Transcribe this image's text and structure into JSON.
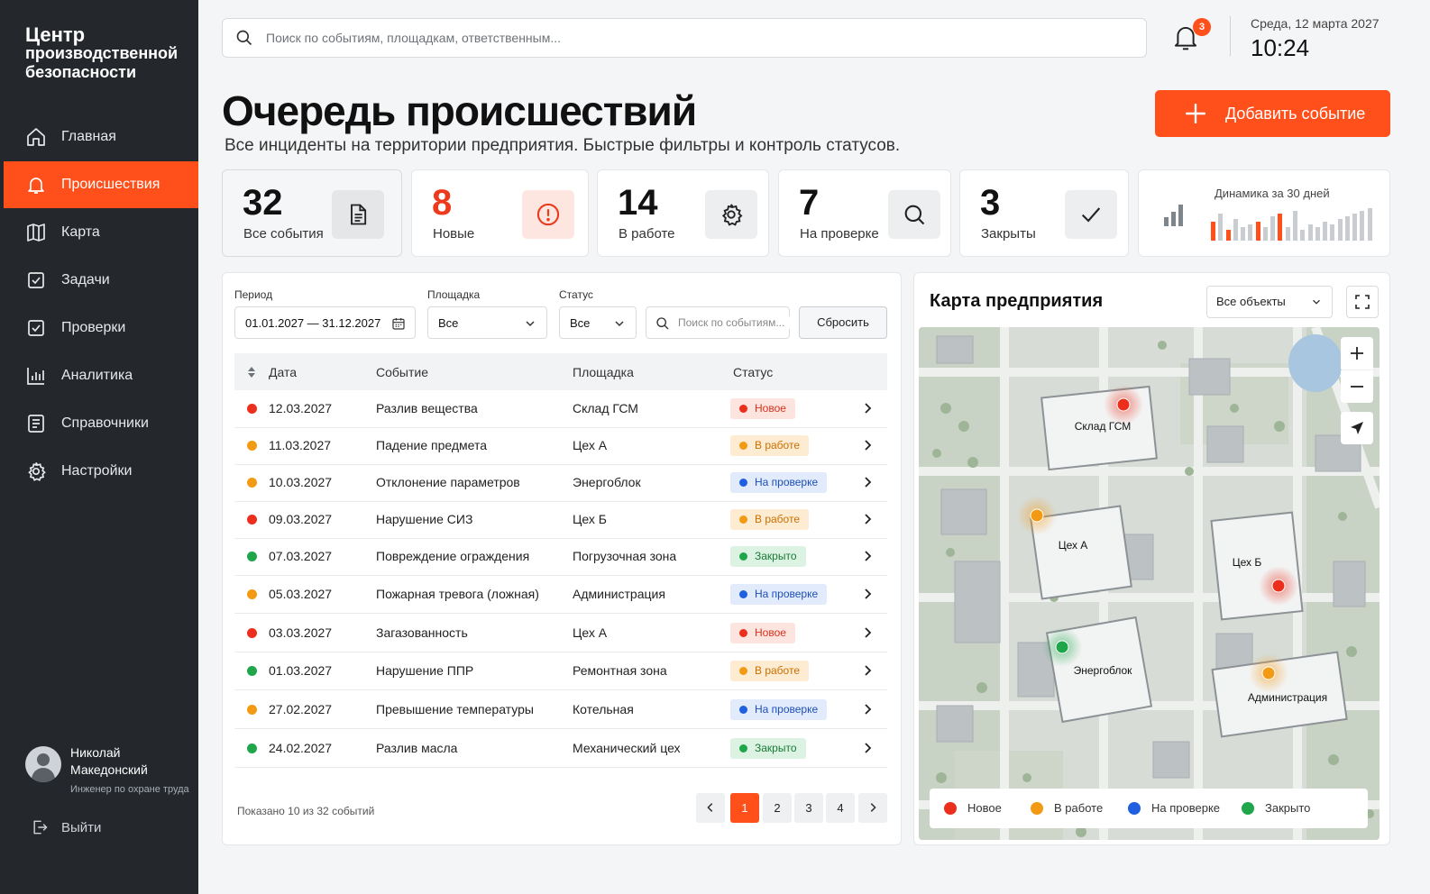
{
  "brand": {
    "line1": "Центр",
    "line2": "производственной",
    "line3": "безопасности"
  },
  "nav": [
    {
      "label": "Главная",
      "icon": "home-icon"
    },
    {
      "label": "Происшествия",
      "icon": "bell-icon"
    },
    {
      "label": "Карта",
      "icon": "map-icon"
    },
    {
      "label": "Задачи",
      "icon": "checkbox-icon"
    },
    {
      "label": "Проверки",
      "icon": "checkbox-icon"
    },
    {
      "label": "Аналитика",
      "icon": "bar-chart-icon"
    },
    {
      "label": "Справочники",
      "icon": "book-icon"
    },
    {
      "label": "Настройки",
      "icon": "gear-icon"
    }
  ],
  "user": {
    "name1": "Николай",
    "name2": "Македонский",
    "role": "Инженер по охране труда",
    "logout": "Выйти"
  },
  "header": {
    "search_placeholder": "Поиск по событиям, площадкам, ответственным...",
    "notifications": "3",
    "date": "Среда, 12 марта 2027",
    "time": "10:24"
  },
  "page": {
    "title": "Очередь происшествий",
    "subtitle": "Все инциденты на территории предприятия. Быстрые фильтры и контроль статусов.",
    "add_button": "Добавить событие"
  },
  "kpis": [
    {
      "value": "32",
      "label": "Все события",
      "icon": "document-icon"
    },
    {
      "value": "8",
      "label": "Новые",
      "icon": "alert-icon"
    },
    {
      "value": "14",
      "label": "В работе",
      "icon": "gear-icon"
    },
    {
      "value": "7",
      "label": "На проверке",
      "icon": "search-icon"
    },
    {
      "value": "3",
      "label": "Закрыты",
      "icon": "check-icon"
    }
  ],
  "dynamics": {
    "title": "Динамика за 30 дней",
    "bars": [
      7,
      10,
      4,
      8,
      5,
      6,
      7,
      5,
      9,
      10,
      5,
      11,
      4,
      6,
      5,
      7,
      6,
      8,
      9,
      10,
      11,
      12
    ],
    "highlight": [
      0,
      2,
      6,
      9
    ]
  },
  "filters": {
    "period_label": "Период",
    "period_value": "01.01.2027 — 31.12.2027",
    "site_label": "Площадка",
    "site_value": "Все",
    "status_label": "Статус",
    "status_value": "Все",
    "search_placeholder": "Поиск по событиям...",
    "reset": "Сбросить"
  },
  "table": {
    "headers": {
      "date": "Дата",
      "event": "Событие",
      "site": "Площадка",
      "status": "Статус"
    },
    "rows": [
      {
        "date": "12.03.2027",
        "event": "Разлив вещества",
        "site": "Склад ГСМ",
        "status": "Новое",
        "kind": "new",
        "severity": "#ec2f1c"
      },
      {
        "date": "11.03.2027",
        "event": "Падение предмета",
        "site": "Цех А",
        "status": "В работе",
        "kind": "work",
        "severity": "#f39a15"
      },
      {
        "date": "10.03.2027",
        "event": "Отклонение параметров",
        "site": "Энергоблок",
        "status": "На проверке",
        "kind": "check",
        "severity": "#f39a15"
      },
      {
        "date": "09.03.2027",
        "event": "Нарушение СИЗ",
        "site": "Цех Б",
        "status": "В работе",
        "kind": "work",
        "severity": "#ec2f1c"
      },
      {
        "date": "07.03.2027",
        "event": "Повреждение ограждения",
        "site": "Погрузочная зона",
        "status": "Закрыто",
        "kind": "closed",
        "severity": "#1fa64a"
      },
      {
        "date": "05.03.2027",
        "event": "Пожарная тревога (ложная)",
        "site": "Администрация",
        "status": "На проверке",
        "kind": "check",
        "severity": "#f39a15"
      },
      {
        "date": "03.03.2027",
        "event": "Загазованность",
        "site": "Цех А",
        "status": "Новое",
        "kind": "new",
        "severity": "#ec2f1c"
      },
      {
        "date": "01.03.2027",
        "event": "Нарушение ППР",
        "site": "Ремонтная зона",
        "status": "В работе",
        "kind": "work",
        "severity": "#1fa64a"
      },
      {
        "date": "27.02.2027",
        "event": "Превышение температуры",
        "site": "Котельная",
        "status": "На проверке",
        "kind": "check",
        "severity": "#f39a15"
      },
      {
        "date": "24.02.2027",
        "event": "Разлив масла",
        "site": "Механический цех",
        "status": "Закрыто",
        "kind": "closed",
        "severity": "#1fa64a"
      }
    ],
    "shown": "Показано 10 из 32 событий",
    "pages": [
      "1",
      "2",
      "3",
      "4"
    ]
  },
  "status_colors": {
    "new": {
      "bg": "#fde4df",
      "dot": "#ec2f1c",
      "fg": "#d8321b"
    },
    "work": {
      "bg": "#fdecd2",
      "dot": "#f39a15",
      "fg": "#cc6f00"
    },
    "check": {
      "bg": "#e2ebfb",
      "dot": "#1f5fe0",
      "fg": "#1c4fb8"
    },
    "closed": {
      "bg": "#dcf2e2",
      "dot": "#1fa64a",
      "fg": "#187a37"
    }
  },
  "map": {
    "title": "Карта предприятия",
    "filter": "Все объекты",
    "buildings": [
      "Склад ГСМ",
      "Цех А",
      "Цех Б",
      "Энергоблок",
      "Администрация"
    ],
    "legend": [
      "Новое",
      "В работе",
      "На проверке",
      "Закрыто"
    ]
  },
  "colors": {
    "accent": "#ff4f1a",
    "sidebar": "#24282d"
  }
}
